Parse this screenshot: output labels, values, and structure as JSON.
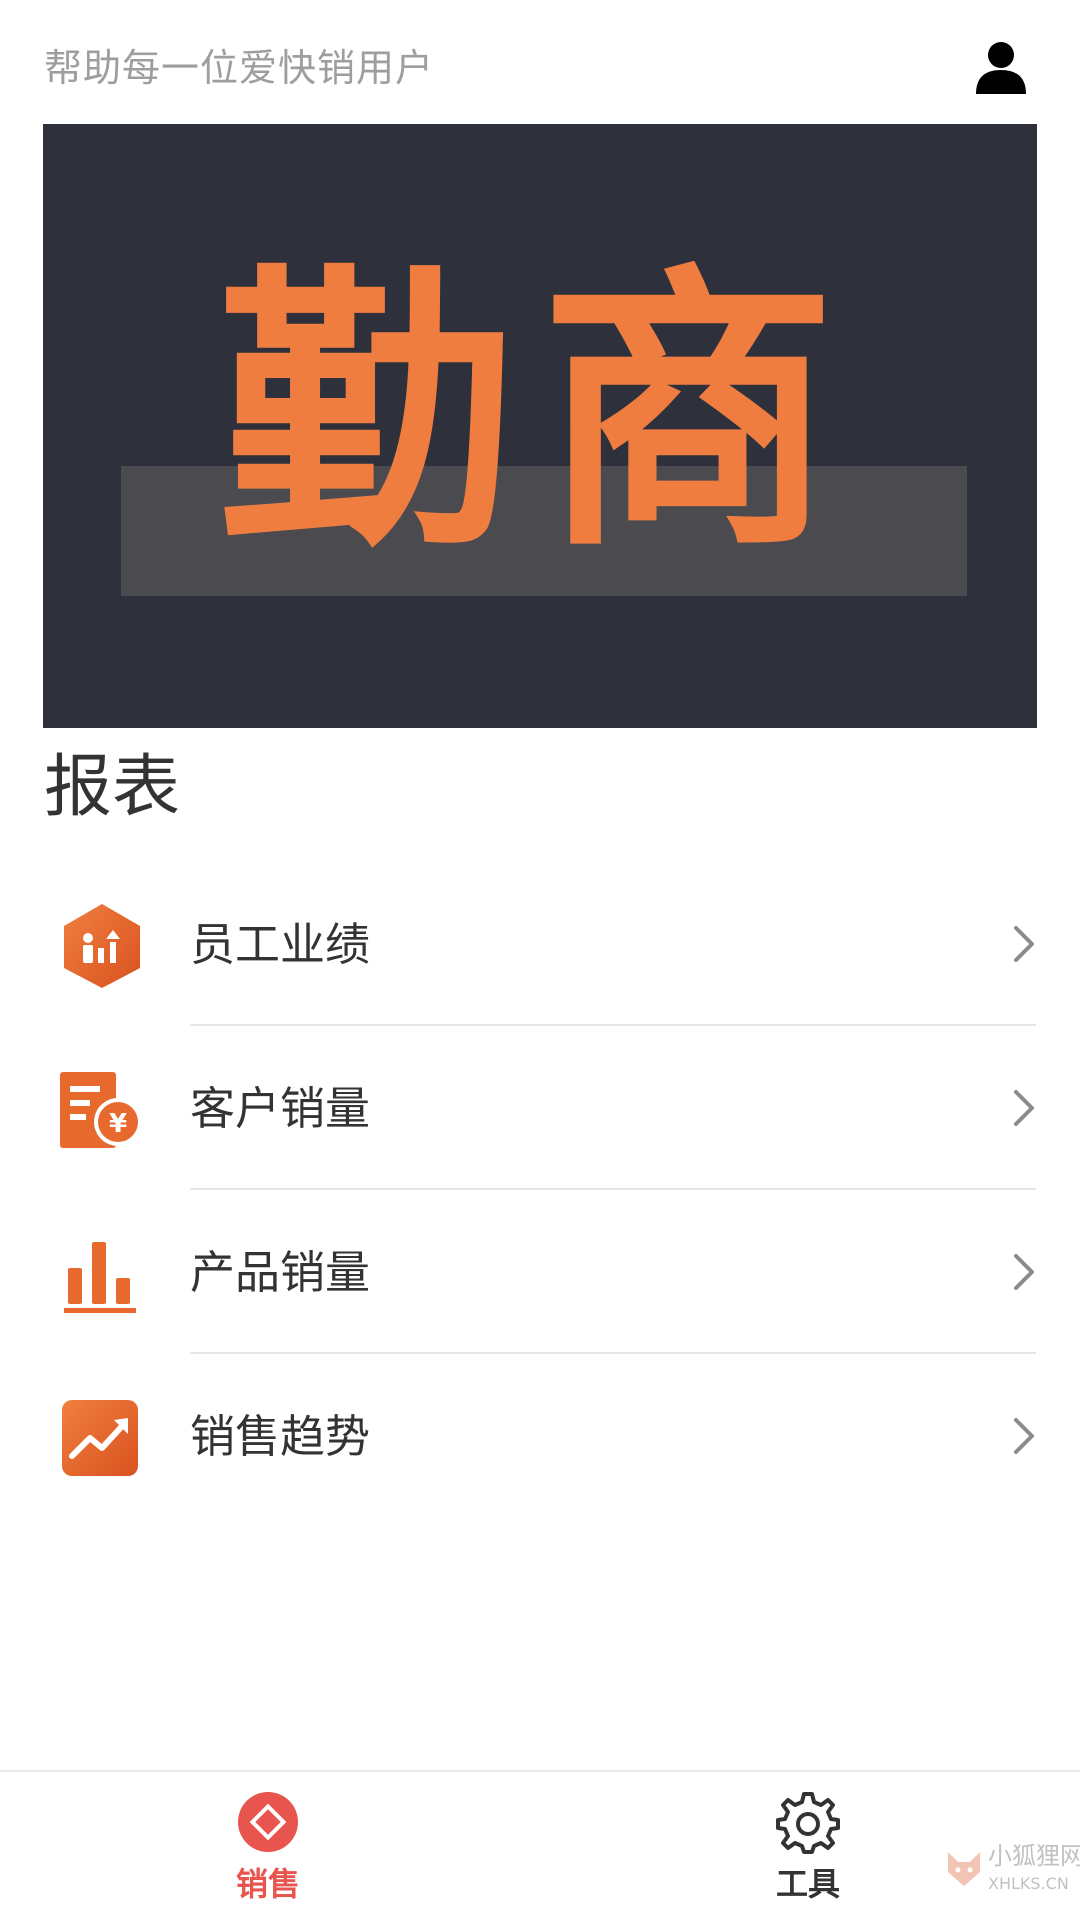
{
  "header": {
    "slogan": "帮助每一位爱快销用户",
    "user_icon": "user-icon"
  },
  "banner": {
    "title": "勤商",
    "background_color": "#2e303b",
    "title_color": "#f07d40"
  },
  "section": {
    "title": "报表"
  },
  "reports": [
    {
      "label": "员工业绩",
      "icon": "staff-performance-icon"
    },
    {
      "label": "客户销量",
      "icon": "customer-sales-icon"
    },
    {
      "label": "产品销量",
      "icon": "product-sales-icon"
    },
    {
      "label": "销售趋势",
      "icon": "sales-trend-icon"
    }
  ],
  "bottom_nav": {
    "items": [
      {
        "label": "销售",
        "icon": "sales-icon",
        "active": true
      },
      {
        "label": "工具",
        "icon": "gear-icon",
        "active": false
      }
    ],
    "active_color": "#e8554e"
  },
  "watermark": {
    "name": "小狐狸网",
    "domain": "XHLKS.CN"
  },
  "colors": {
    "accent": "#e8554e",
    "icon_orange": "#e8692e",
    "divider": "#e6e6e6"
  }
}
